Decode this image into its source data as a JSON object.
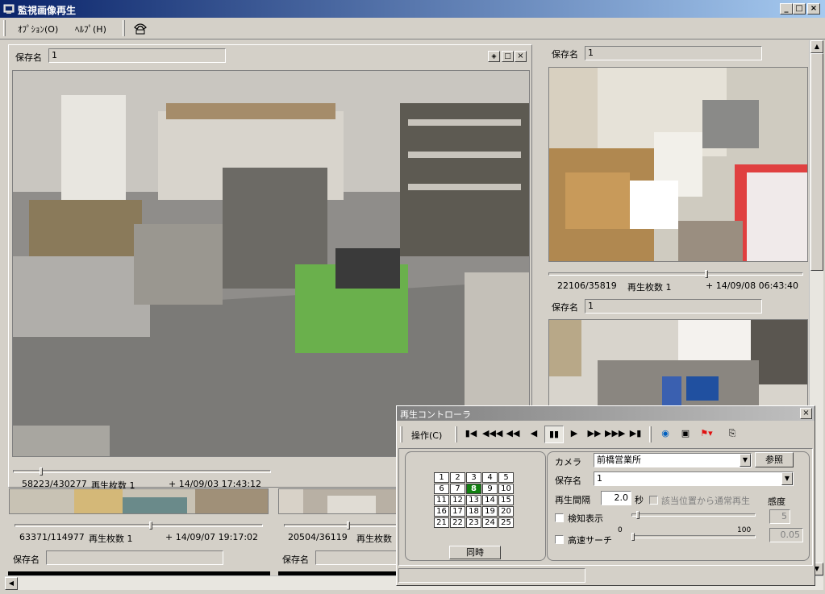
{
  "window": {
    "title": "監視画像再生"
  },
  "menu": {
    "options": "ｵﾌﾟｼｮﾝ(O)",
    "help": "ﾍﾙﾌﾟ(H)"
  },
  "main_view": {
    "save_name_label": "保存名",
    "save_name_value": "1",
    "frame_counter": "58223/430277",
    "play_count_label": "再生枚数 1",
    "timestamp": "+ 14/09/03 17:43:12",
    "slider_position": 0.11
  },
  "cam_top_right": {
    "save_name_label": "保存名",
    "save_name_value": "1",
    "frame_counter": "22106/35819",
    "play_count_label": "再生枚数 1",
    "timestamp": "+ 14/09/08 06:43:40",
    "slider_position": 0.62
  },
  "cam_mid_right": {
    "save_name_label": "保存名",
    "save_name_value": "1"
  },
  "cam_bottom_left": {
    "frame_counter": "63371/114977",
    "play_count_label": "再生枚数 1",
    "timestamp": "+ 14/09/07 19:17:02",
    "save_name_label": "保存名",
    "slider_position": 0.55
  },
  "cam_bottom_mid": {
    "frame_counter": "20504/36119",
    "play_count_label": "再生枚数",
    "save_name_label": "保存名",
    "slider_position": 0.57
  },
  "controller": {
    "title": "再生コントローラ",
    "operation_menu": "操作(C)",
    "toolbar_icons": [
      "skip-start-icon",
      "fast-rewind-3-icon",
      "fast-rewind-2-icon",
      "step-back-icon",
      "pause-icon",
      "play-icon",
      "fast-forward-2-icon",
      "fast-forward-3-icon",
      "skip-end-icon",
      "sync-icon",
      "save-icon",
      "flag-icon",
      "export-icon"
    ],
    "grid": [
      "1",
      "2",
      "3",
      "4",
      "5",
      "6",
      "7",
      "8",
      "9",
      "10",
      "11",
      "12",
      "13",
      "14",
      "15",
      "16",
      "17",
      "18",
      "19",
      "20",
      "21",
      "22",
      "23",
      "24",
      "25"
    ],
    "active_cell": "8",
    "sync_button": "同時",
    "camera_label": "カメラ",
    "camera_value": "前橋営業所",
    "browse_button": "参照",
    "save_name_label": "保存名",
    "save_name_value": "1",
    "interval_label": "再生間隔",
    "interval_value": "2.0",
    "interval_unit": "秒",
    "normal_play_label": "該当位置から通常再生",
    "sensitivity_label": "感度",
    "detect_label": "検知表示",
    "sensitivity_value": "5",
    "range_min": "0",
    "range_max": "100",
    "fast_search_label": "高速サーチ",
    "threshold_value": "0.05"
  },
  "colors": {
    "titlebar_start": "#0a246a",
    "titlebar_end": "#a6caf0",
    "active_cell": "#108010"
  }
}
